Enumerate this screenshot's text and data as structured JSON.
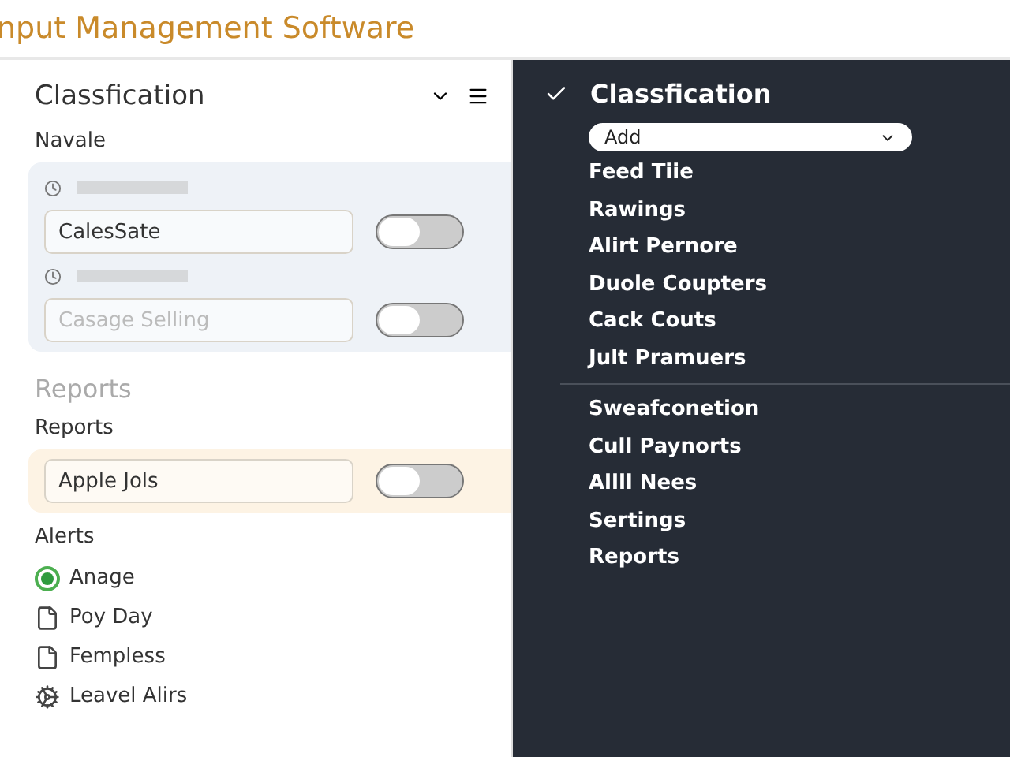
{
  "app_title": "nput Management Software",
  "left_panel": {
    "title": "Classfication",
    "navale": {
      "label": "Navale",
      "entries": [
        {
          "value": "CalesSate",
          "on": false
        },
        {
          "placeholder": "Casage Selling",
          "on": false
        }
      ]
    },
    "reports_heading": "Reports",
    "reports": {
      "label": "Reports",
      "entries": [
        {
          "value": "Apple Jols",
          "on": false
        }
      ]
    },
    "alerts": {
      "label": "Alerts",
      "items": [
        {
          "kind": "radio",
          "label": "Anage",
          "selected": true
        },
        {
          "kind": "file",
          "label": "Poy Day"
        },
        {
          "kind": "file",
          "label": "Fempless"
        },
        {
          "kind": "gear",
          "label": "Leavel Alirs"
        }
      ]
    }
  },
  "right_panel": {
    "title": "Classfication",
    "dropdown": {
      "value": "Add"
    },
    "groups": [
      [
        "Feed Tiie",
        "Rawings",
        "Alirt Pernore",
        "Duole Coupters",
        "Cack Couts",
        "Jult Pramuers"
      ],
      [
        "Sweafconetion",
        "Cull Paynorts",
        "Allll Nees",
        "Sertings",
        "Reports"
      ]
    ]
  }
}
